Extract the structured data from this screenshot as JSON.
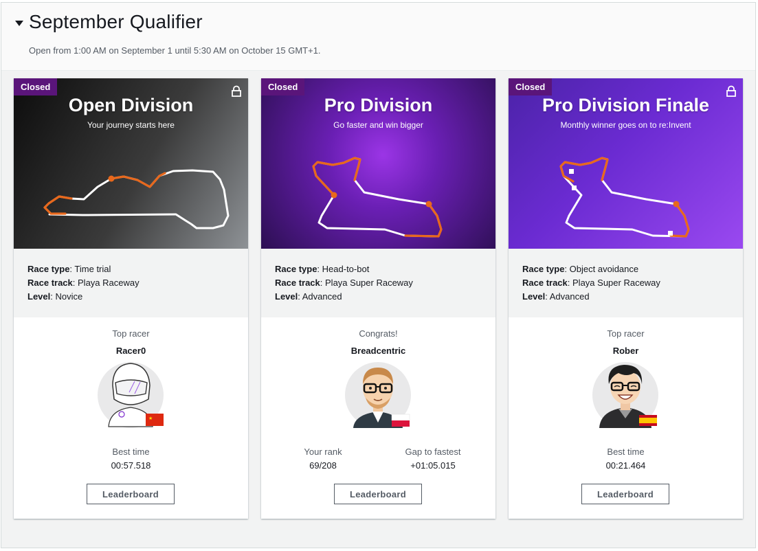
{
  "section": {
    "title": "September Qualifier",
    "subtitle": "Open from 1:00 AM on September 1 until 5:30 AM on October 15 GMT+1."
  },
  "labels": {
    "race_type": "Race type",
    "race_track": "Race track",
    "level": "Level",
    "leaderboard": "Leaderboard"
  },
  "cards": [
    {
      "status": "Closed",
      "locked": true,
      "title": "Open Division",
      "tagline": "Your journey starts here",
      "race_type": "Time trial",
      "race_track": "Playa Raceway",
      "level": "Novice",
      "racer_heading": "Top racer",
      "racer_name": "Racer0",
      "flag": "China",
      "stat_label": "Best time",
      "stat_value": "00:57.518"
    },
    {
      "status": "Closed",
      "locked": false,
      "title": "Pro Division",
      "tagline": "Go faster and win bigger",
      "race_type": "Head-to-bot",
      "race_track": "Playa Super Raceway",
      "level": "Advanced",
      "racer_heading": "Congrats!",
      "racer_name": "Breadcentric",
      "flag": "Poland",
      "rank_label": "Your rank",
      "rank_value": "69/208",
      "gap_label": "Gap to fastest",
      "gap_value": "+01:05.015"
    },
    {
      "status": "Closed",
      "locked": true,
      "title": "Pro Division Finale",
      "tagline": "Monthly winner goes on to re:Invent",
      "race_type": "Object avoidance",
      "race_track": "Playa Super Raceway",
      "level": "Advanced",
      "racer_heading": "Top racer",
      "racer_name": "Rober",
      "flag": "Spain",
      "stat_label": "Best time",
      "stat_value": "00:21.464"
    }
  ],
  "colors": {
    "badge": "#5a157a",
    "track_highlight": "#e8681c",
    "track": "#ffffff"
  }
}
